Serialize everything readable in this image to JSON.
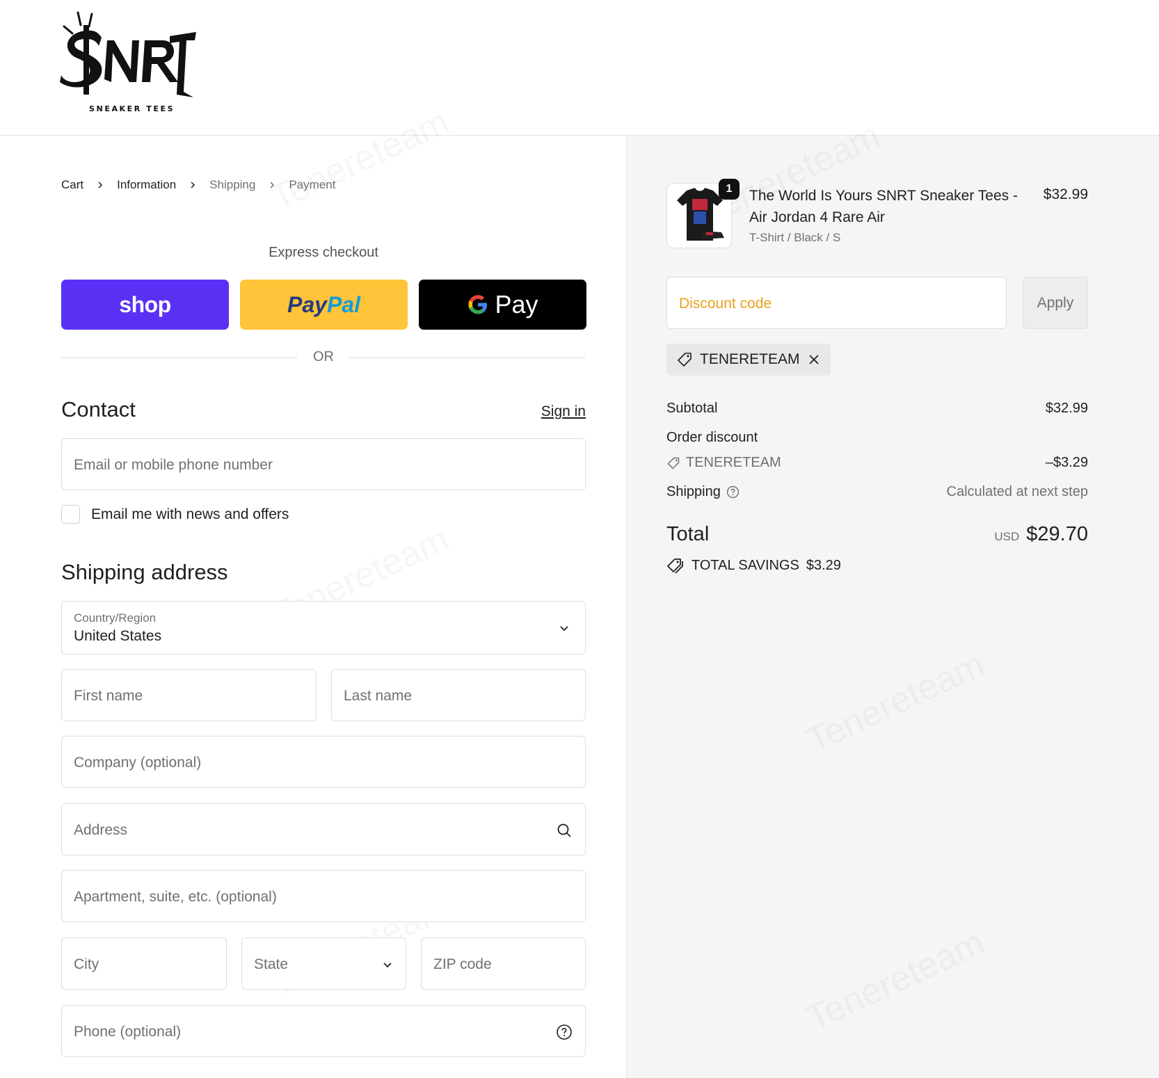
{
  "brand": {
    "logo_text": "SNRT",
    "logo_subtitle": "SNEAKER TEES"
  },
  "breadcrumb": [
    "Cart",
    "Information",
    "Shipping",
    "Payment"
  ],
  "express": {
    "title": "Express checkout",
    "shop_label": "shop",
    "paypal_label_1": "Pay",
    "paypal_label_2": "Pal",
    "gpay_label": "Pay",
    "or_label": "OR"
  },
  "contact": {
    "title": "Contact",
    "signin_label": "Sign in",
    "email_placeholder": "Email or mobile phone number",
    "newsletter_label": "Email me with news and offers"
  },
  "shipping": {
    "title": "Shipping address",
    "country_label": "Country/Region",
    "country_value": "United States",
    "first_name": "First name",
    "last_name": "Last name",
    "company": "Company (optional)",
    "address": "Address",
    "apartment": "Apartment, suite, etc. (optional)",
    "city": "City",
    "state": "State",
    "zip": "ZIP code",
    "phone": "Phone (optional)"
  },
  "summary": {
    "product": {
      "quantity": "1",
      "name": "The World Is Yours SNRT Sneaker Tees - Air Jordan 4 Rare Air",
      "variant": "T-Shirt / Black / S",
      "price": "$32.99"
    },
    "discount_placeholder": "Discount code",
    "apply_label": "Apply",
    "applied_code": "TENERETEAM",
    "subtotal_label": "Subtotal",
    "subtotal_value": "$32.99",
    "order_discount_label": "Order discount",
    "order_discount_code": "TENERETEAM",
    "order_discount_value": "–$3.29",
    "shipping_label": "Shipping",
    "shipping_value": "Calculated at next step",
    "total_label": "Total",
    "total_currency": "USD",
    "total_value": "$29.70",
    "savings_label": "TOTAL SAVINGS",
    "savings_value": "$3.29"
  },
  "colors": {
    "shop_purple": "#5a31f4",
    "paypal_yellow": "#ffc439",
    "gpay_black": "#000000",
    "discount_placeholder": "#e7a21a",
    "summary_bg": "#f5f5f5"
  },
  "icons": [
    "chevron-right-icon",
    "chevron-down-icon",
    "search-icon",
    "help-circle-icon",
    "tag-icon",
    "close-icon",
    "tags-icon"
  ]
}
